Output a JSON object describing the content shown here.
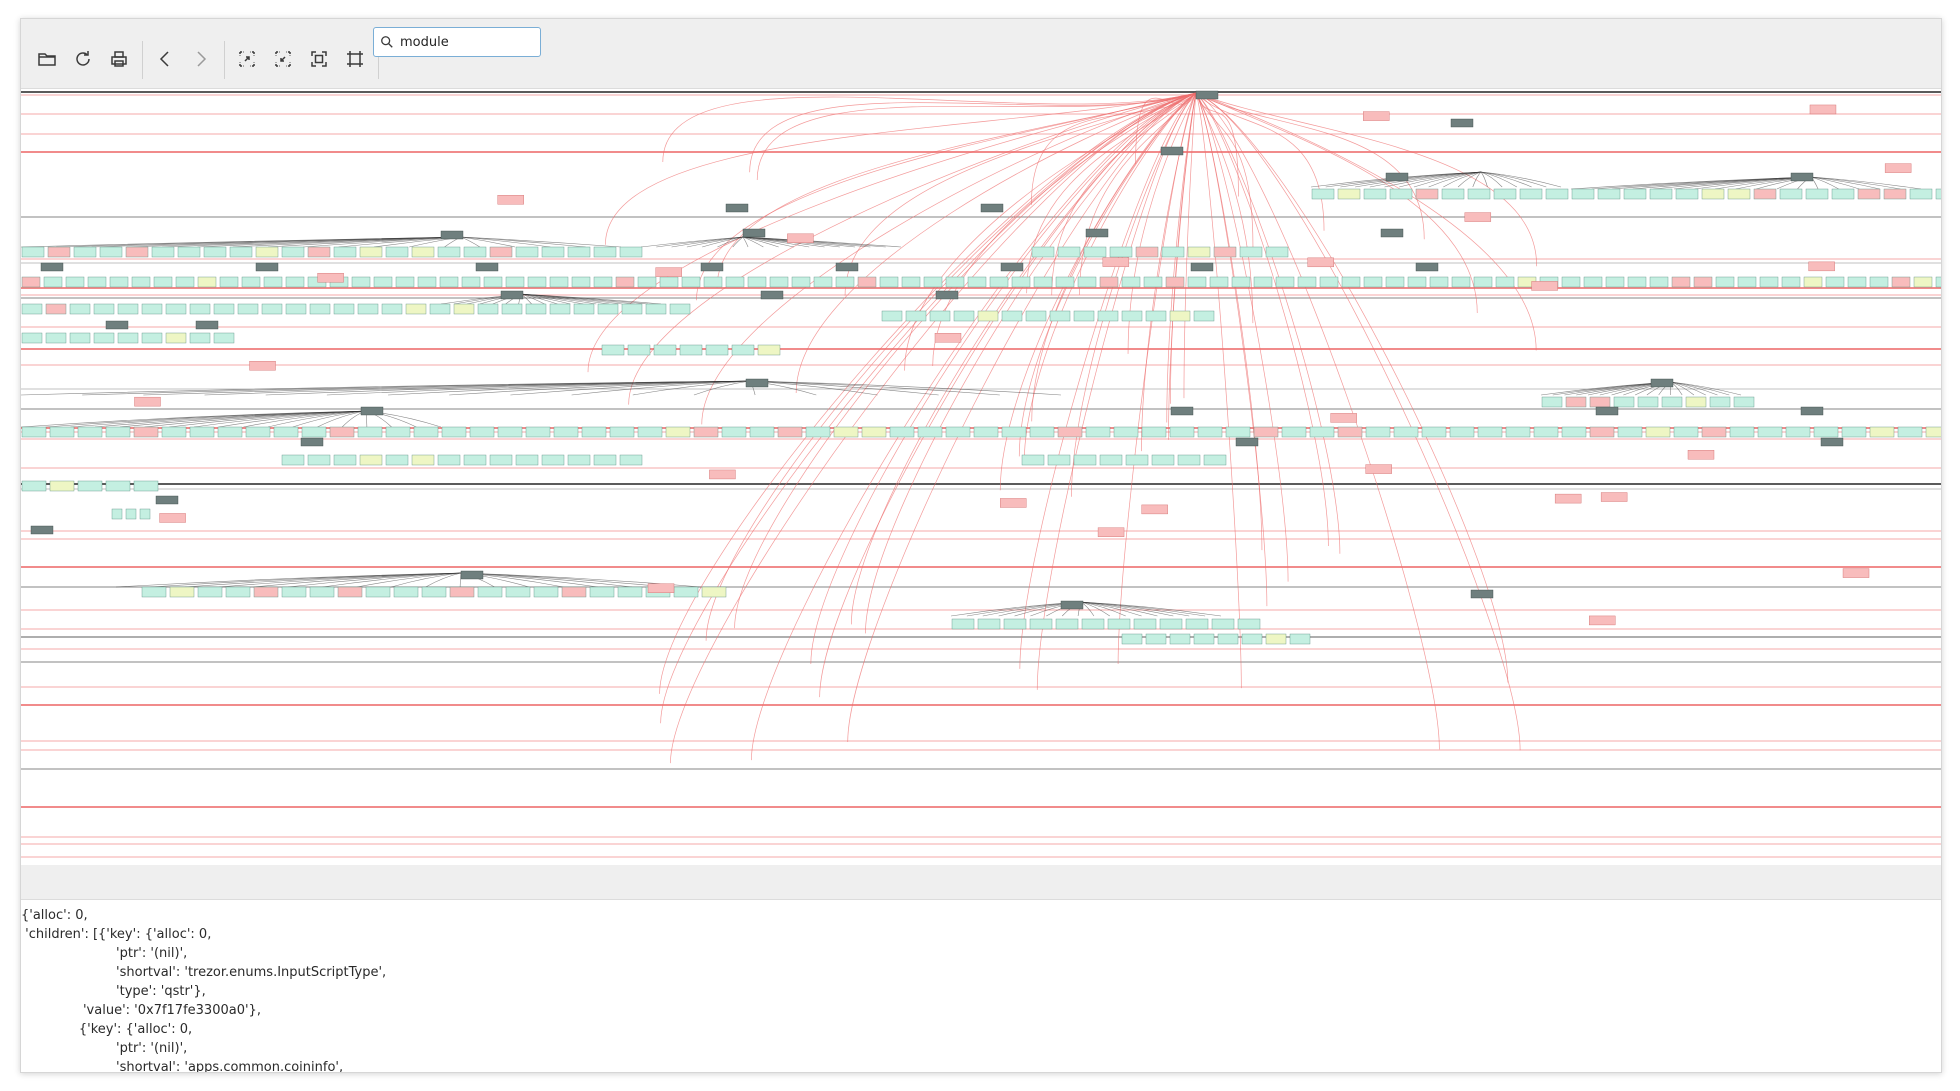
{
  "toolbar": {
    "buttons": [
      {
        "icon": "folder-open-icon",
        "title": "Open"
      },
      {
        "icon": "reload-icon",
        "title": "Reload"
      },
      {
        "icon": "print-icon",
        "title": "Print"
      },
      {
        "icon": "back-icon",
        "title": "Back"
      },
      {
        "icon": "forward-icon",
        "title": "Forward"
      },
      {
        "icon": "zoom-in-icon",
        "title": "Zoom in"
      },
      {
        "icon": "zoom-out-icon",
        "title": "Zoom out"
      },
      {
        "icon": "zoom-fit-icon",
        "title": "Zoom fit"
      },
      {
        "icon": "zoom-100-icon",
        "title": "Zoom 100%"
      }
    ]
  },
  "search": {
    "value": "module",
    "placeholder": ""
  },
  "graph": {
    "description": "object reference graph",
    "node_colors": {
      "heading": "#6f7f7e",
      "normal": "#c4efe1",
      "highlight": "#f8bcbc",
      "yellow": "#eef6c4"
    },
    "edge_colors": {
      "ref": "#ee6f6f",
      "dark": "#333333",
      "grey": "#9a9a9a"
    }
  },
  "details_text": "{'alloc': 0,\n 'children': [{'key': {'alloc': 0,\n                       'ptr': '(nil)',\n                       'shortval': 'trezor.enums.InputScriptType',\n                       'type': 'qstr'},\n               'value': '0x7f17fe3300a0'},\n              {'key': {'alloc': 0,\n                       'ptr': '(nil)',\n                       'shortval': 'apps.common.coininfo',"
}
